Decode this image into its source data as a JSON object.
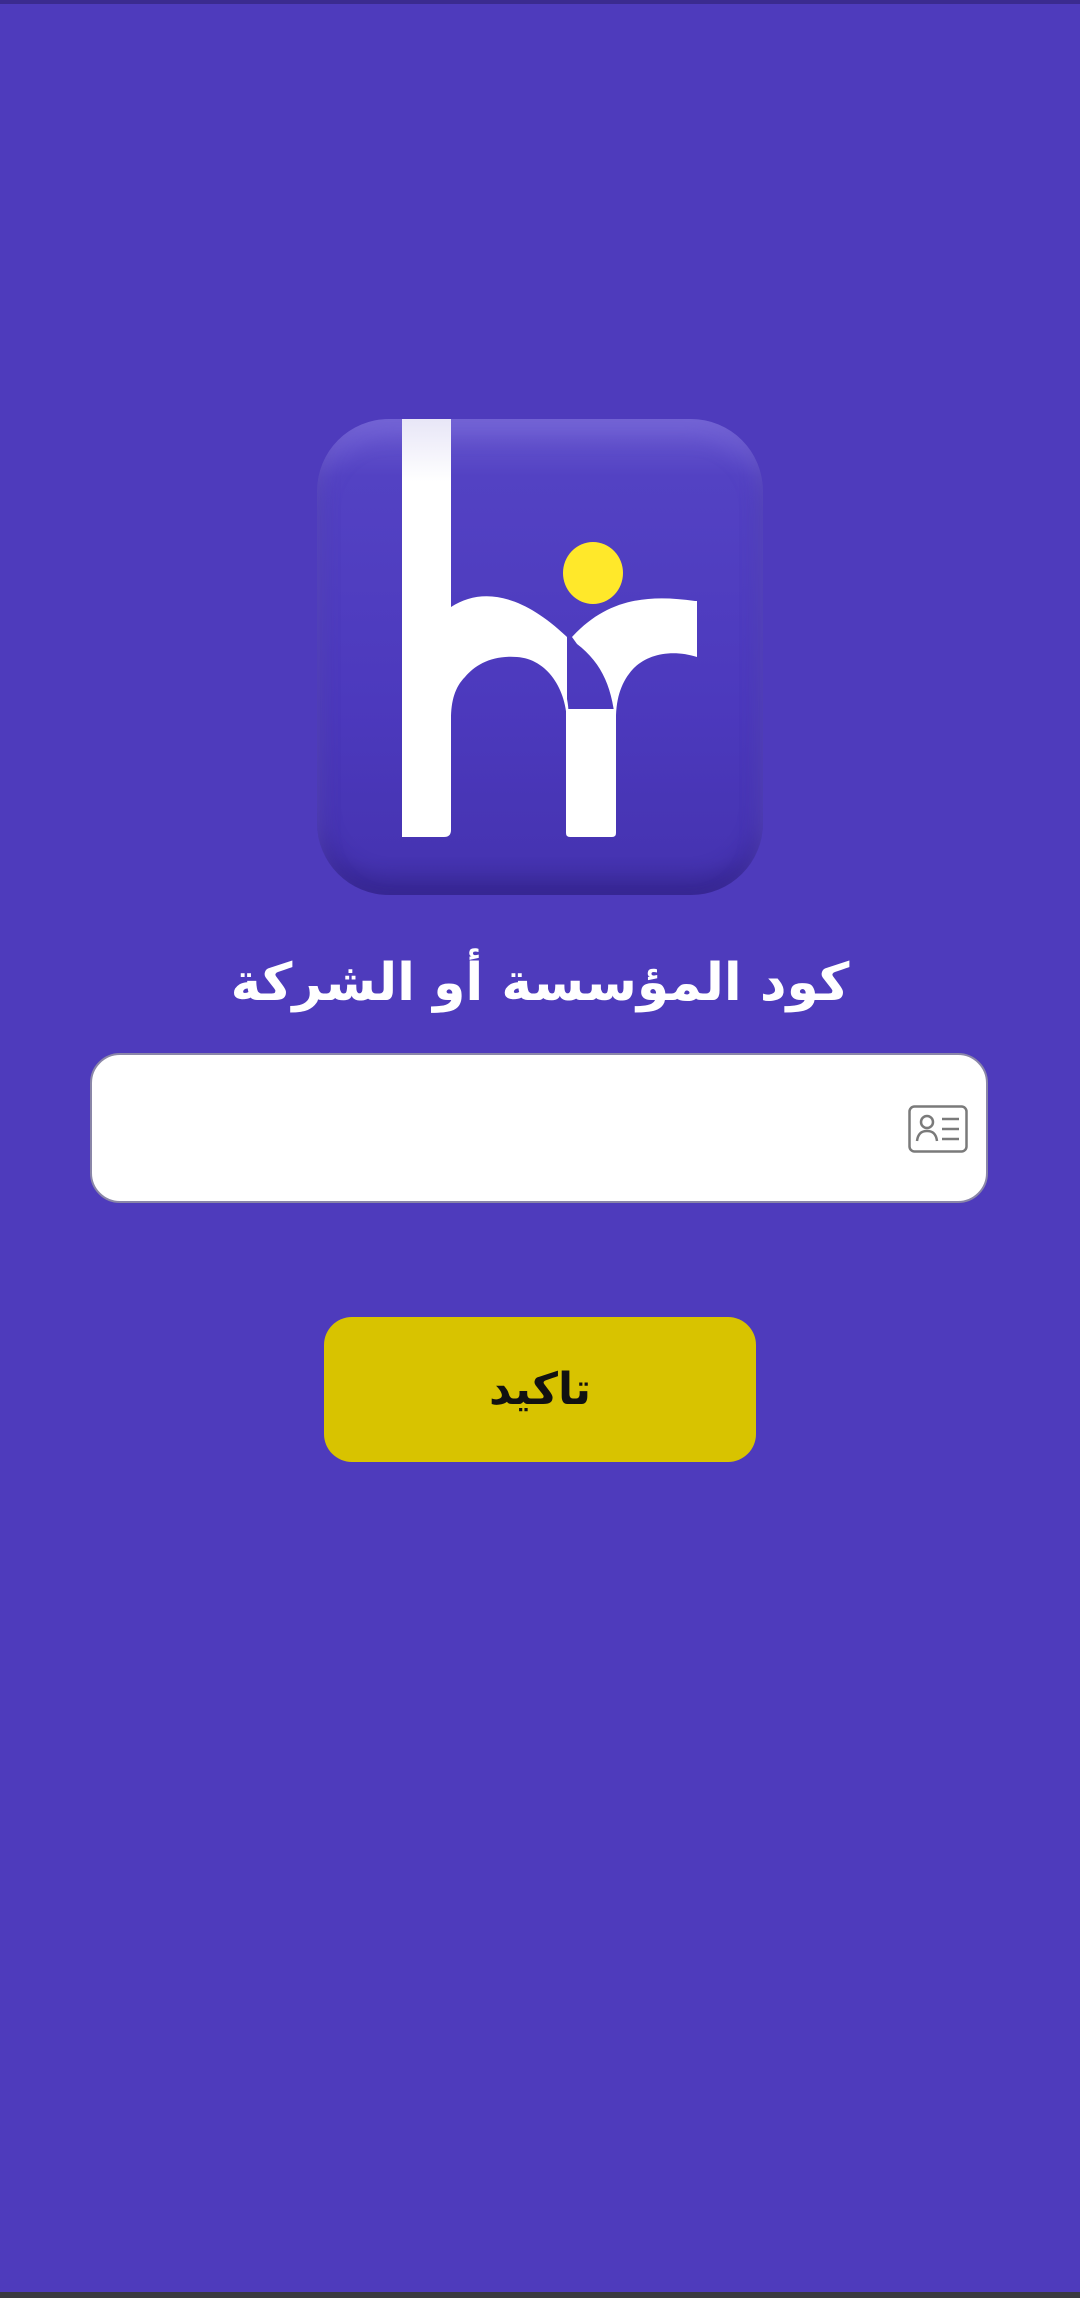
{
  "app": {
    "logo_icon": "hr-logo-icon",
    "accent_color": "#4e3bbc",
    "logo_dot_color": "#ffe82a"
  },
  "form": {
    "title": "كود المؤسسة أو الشركة",
    "code_input": {
      "value": "",
      "placeholder": "",
      "icon": "id-card-icon"
    },
    "confirm_label": "تاكيد",
    "confirm_color": "#d8c300"
  }
}
